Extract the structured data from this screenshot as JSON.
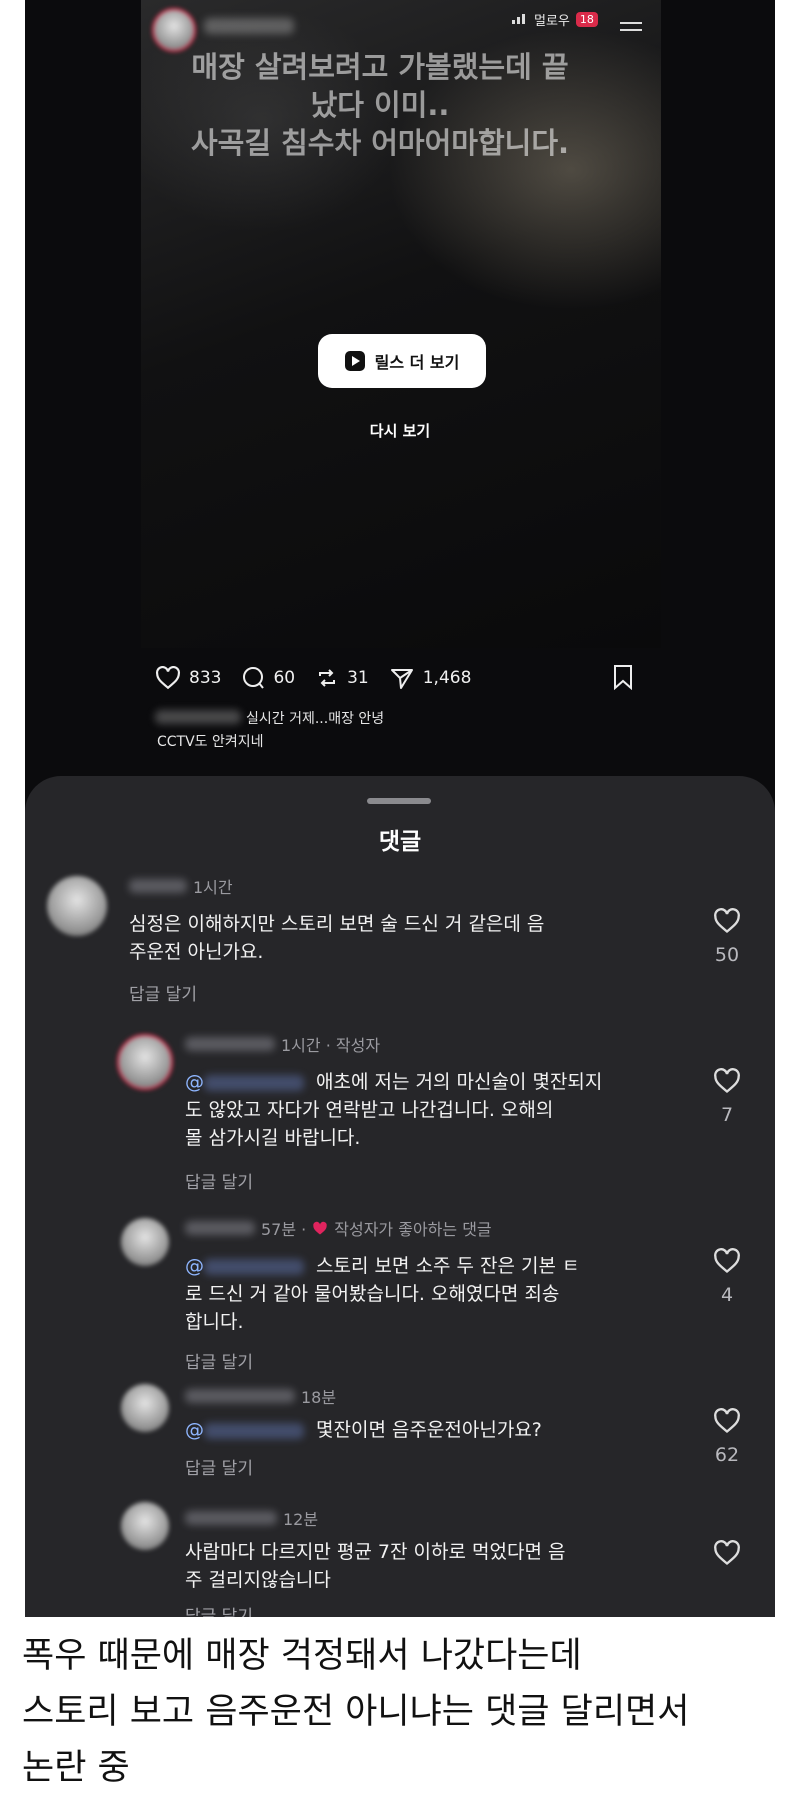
{
  "story": {
    "status": {
      "carrier": "멀로우",
      "battery": "18"
    },
    "overlay_lines": [
      "매장 살려보려고 가볼랬는데 끝",
      "났다 이미..",
      "사곡길 침수차 어마어마합니다."
    ],
    "reels_button": "릴스 더 보기",
    "replay": "다시 보기"
  },
  "post": {
    "likes": "833",
    "comments": "60",
    "reposts": "31",
    "shares": "1,468",
    "caption_line1": "실시간 거제...매장 안녕",
    "caption_line2": "CCTV도 안켜지네"
  },
  "sheet": {
    "title": "댓글",
    "comments": [
      {
        "time": "1시간",
        "text_lines": [
          "심정은 이해하지만 스토리 보면 술 드신 거 같은데 음",
          "주운전 아닌가요."
        ],
        "reply": "답글 달기",
        "likes": "50"
      },
      {
        "time": "1시간 · 작성자",
        "mention": "@",
        "text_lines": [
          "애초에 저는 거의 마신술이 몇잔되지",
          "도 않았고 자다가 연락받고 나간겁니다. 오해의",
          "몰 삼가시길 바랍니다."
        ],
        "reply": "답글 달기",
        "likes": "7"
      },
      {
        "time": "57분 ·",
        "badge": "작성자가 좋아하는 댓글",
        "mention": "@",
        "text_lines": [
          "스토리 보면 소주 두 잔은 기본 ㅌ",
          "로 드신 거 같아 물어봤습니다. 오해였다면 죄송",
          "합니다."
        ],
        "reply": "답글 달기",
        "likes": "4"
      },
      {
        "time": "18분",
        "mention": "@",
        "text_lines": [
          "몇잔이면 음주운전아닌가요?"
        ],
        "reply": "답글 달기",
        "likes": "62"
      },
      {
        "time": "12분",
        "text_lines": [
          "사람마다 다르지만 평균 7잔 이하로 먹었다면 음",
          "주 걸리지않습니다"
        ],
        "reply": "답글 달기",
        "likes": ""
      }
    ]
  },
  "footer_lines": [
    "폭우 때문에 매장 걱정돼서 나갔다는데",
    "스토리 보고 음주운전 아니냐는 댓글 달리면서",
    "논란 중"
  ],
  "colors": {
    "background": "#0b0b0d",
    "sheet": "#262629",
    "accent_red": "#d92b4a",
    "mention": "#8fb6ff"
  }
}
